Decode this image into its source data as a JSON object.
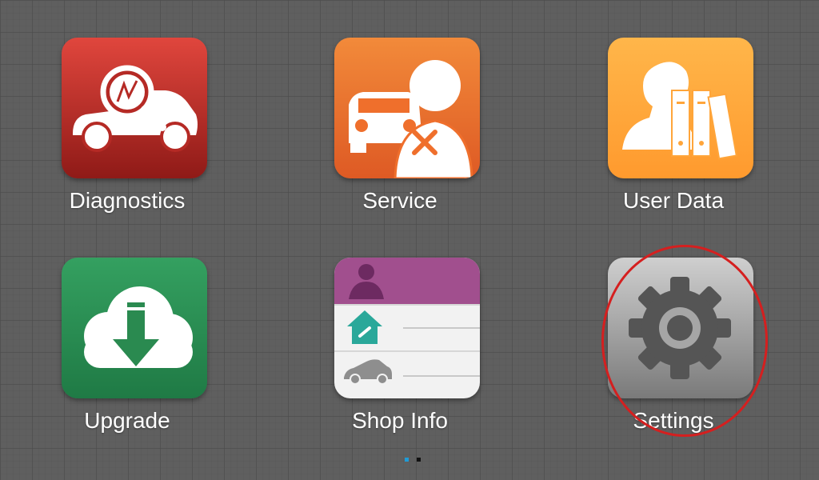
{
  "apps": [
    {
      "id": "diagnostics",
      "label": "Diagnostics"
    },
    {
      "id": "service",
      "label": "Service"
    },
    {
      "id": "user-data",
      "label": "User Data"
    },
    {
      "id": "upgrade",
      "label": "Upgrade"
    },
    {
      "id": "shop-info",
      "label": "Shop Info"
    },
    {
      "id": "settings",
      "label": "Settings",
      "highlighted": true
    }
  ],
  "pager": {
    "pages": 2,
    "current": 1
  },
  "colors": {
    "diagnostics": "#b52a25",
    "service": "#ef6f2c",
    "user_data": "#ffa53a",
    "upgrade": "#2a8a50",
    "shop_info_header": "#a14f8e",
    "settings": "#b6b6b6",
    "highlight": "#d51f1f",
    "pager_active": "#1f9bd6"
  }
}
